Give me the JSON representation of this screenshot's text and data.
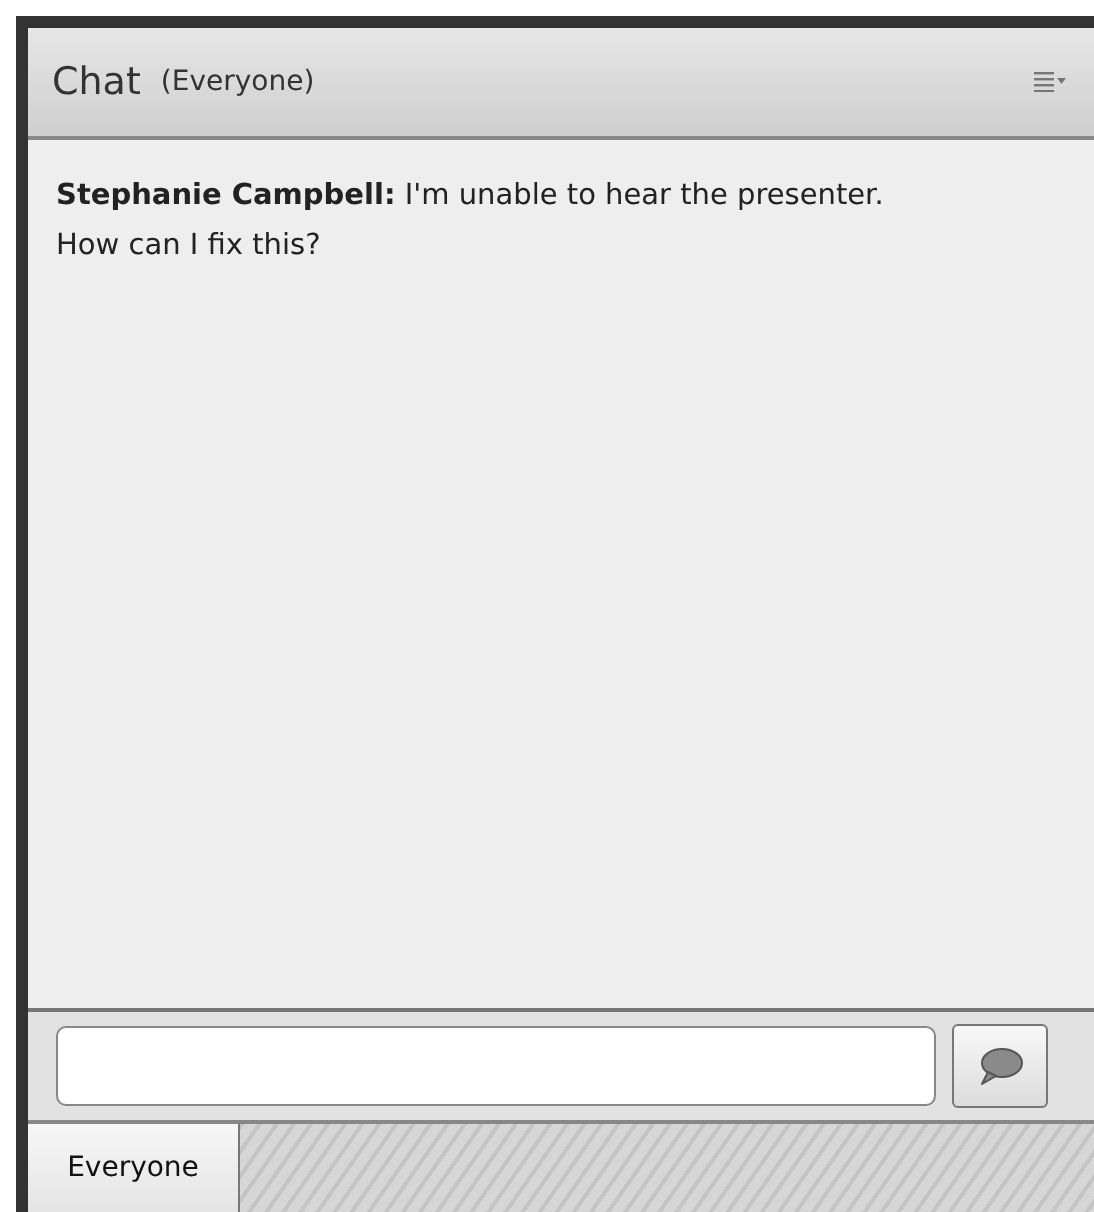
{
  "panel": {
    "title": "Chat",
    "audience": "(Everyone)"
  },
  "messages": [
    {
      "text": "**Stephanie Campbell:** I'm unable to hear the presenter. How can I fix this?"
    }
  ],
  "tabs": [
    {
      "label": "Everyone",
      "selected": true
    }
  ]
}
